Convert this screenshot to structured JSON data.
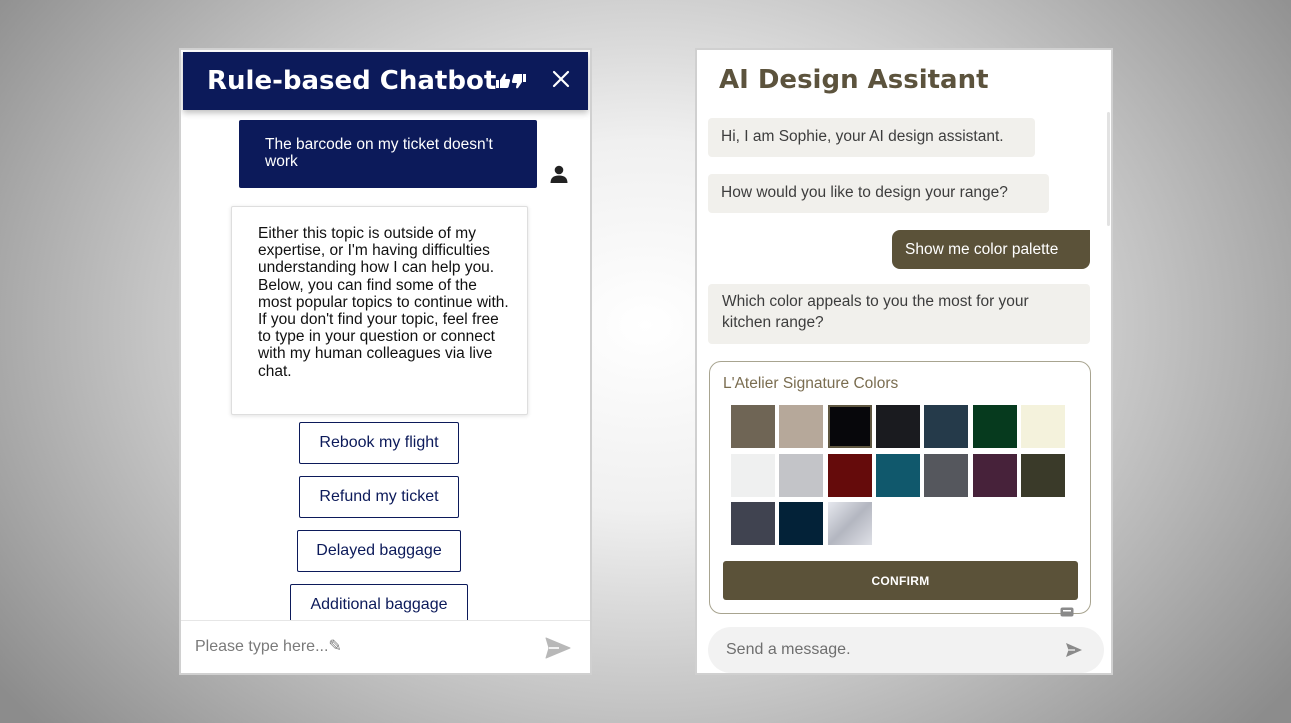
{
  "left_chat": {
    "title": "Rule-based Chatbot",
    "header_icons": [
      "thumbs-up-down-icon",
      "close-icon"
    ],
    "user_message": "The barcode on my ticket doesn't work",
    "bot_message": "Either this topic is outside of my expertise, or I'm having difficulties understanding how I can help you. Below, you can find some of the most popular topics to continue with. If you don't find your topic, feel free to type in your question or connect with my human colleagues via live chat.",
    "quick_replies": [
      "Rebook my flight",
      "Refund my ticket",
      "Delayed baggage",
      "Additional baggage"
    ],
    "input_placeholder": "Please type here...✎",
    "send_icon": "send-icon",
    "colors": {
      "header": "#0c1a5a",
      "accent": "#0c1a5a"
    }
  },
  "right_chat": {
    "title": "AI Design Assitant",
    "messages": [
      {
        "from": "bot",
        "text": "Hi, I am Sophie, your AI design assistant."
      },
      {
        "from": "bot",
        "text": "How would you like to design your range?"
      },
      {
        "from": "user",
        "text": "Show me color palette"
      },
      {
        "from": "bot",
        "text": "Which color appeals to you the most for your kitchen range?"
      }
    ],
    "palette": {
      "title": "L'Atelier Signature Colors",
      "selected_index": 2,
      "swatches": [
        "#6f6555",
        "#b6a89a",
        "#07070b",
        "#1a1b1f",
        "#253a4a",
        "#063a1e",
        "#f4f2dc",
        "#eff0f0",
        "#c3c4c8",
        "#650b0b",
        "#10586c",
        "#55575d",
        "#47223a",
        "#3a3a29",
        "#404350",
        "#032238",
        "#c5c7cf"
      ],
      "confirm_label": "CONFIRM"
    },
    "input_placeholder": "Send a message.",
    "send_icon": "send-icon",
    "colors": {
      "title": "#5c533d",
      "accent": "#5b5239",
      "bot_bubble": "#f1f0ec"
    }
  }
}
